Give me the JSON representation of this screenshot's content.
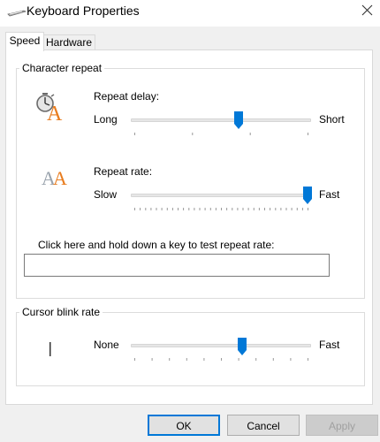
{
  "window": {
    "title": "Keyboard Properties"
  },
  "tabs": [
    {
      "label": "Speed",
      "active": true
    },
    {
      "label": "Hardware",
      "active": false
    }
  ],
  "character_repeat": {
    "legend": "Character repeat",
    "repeat_delay": {
      "label": "Repeat delay:",
      "min_label": "Long",
      "max_label": "Short",
      "value": 0.6,
      "tick_count": 4
    },
    "repeat_rate": {
      "label": "Repeat rate:",
      "min_label": "Slow",
      "max_label": "Fast",
      "value": 1.0,
      "tick_count": 33
    },
    "test_prompt": "Click here and hold down a key to test repeat rate:",
    "test_input_value": ""
  },
  "cursor_blink": {
    "legend": "Cursor blink rate",
    "min_label": "None",
    "max_label": "Fast",
    "value": 0.62,
    "tick_count": 11
  },
  "buttons": {
    "ok": "OK",
    "cancel": "Cancel",
    "apply": "Apply"
  },
  "colors": {
    "accent": "#0078d7",
    "orange_icon": "#e87c1e",
    "disabled_text": "#a0a0a0"
  }
}
